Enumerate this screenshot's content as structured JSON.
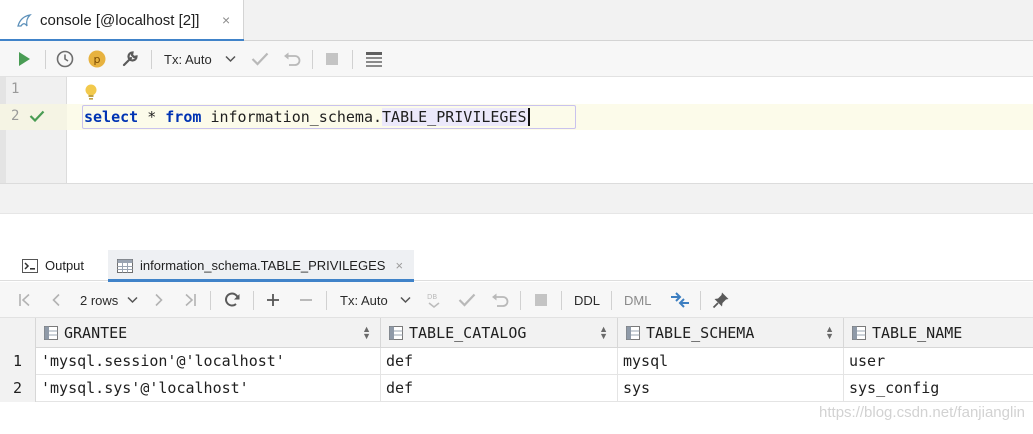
{
  "console_tab": {
    "title": "console [@localhost [2]]",
    "close": "×"
  },
  "editor_toolbar": {
    "tx_mode": "Tx: Auto",
    "buttons": [
      "run",
      "history",
      "profile",
      "settings",
      "tx-mode",
      "commit",
      "rollback",
      "stop",
      "output-format"
    ]
  },
  "editor": {
    "line_numbers": [
      "1",
      "2"
    ],
    "statement": {
      "select": "select",
      "star": "*",
      "from": "from",
      "schema": "information_schema.",
      "table": "TABLE_PRIVILEGES"
    }
  },
  "results_tabs": [
    {
      "label": "Output",
      "icon": "output-icon"
    },
    {
      "label": "information_schema.TABLE_PRIVILEGES",
      "icon": "table-icon",
      "close": "×"
    }
  ],
  "results_toolbar": {
    "rows": "2 rows",
    "tx_mode": "Tx: Auto",
    "ddl": "DDL",
    "dml": "DML"
  },
  "grid": {
    "columns": [
      "GRANTEE",
      "TABLE_CATALOG",
      "TABLE_SCHEMA",
      "TABLE_NAME"
    ],
    "rows": [
      {
        "num": "1",
        "cells": [
          "'mysql.session'@'localhost'",
          "def",
          "mysql",
          "user"
        ]
      },
      {
        "num": "2",
        "cells": [
          "'mysql.sys'@'localhost'",
          "def",
          "sys",
          "sys_config"
        ]
      }
    ]
  },
  "watermark": "https://blog.csdn.net/fanjianglin",
  "colors": {
    "accent": "#4083c9",
    "keyword": "#0033b3",
    "run_green": "#499c54",
    "profile_orange": "#e7b23f"
  }
}
